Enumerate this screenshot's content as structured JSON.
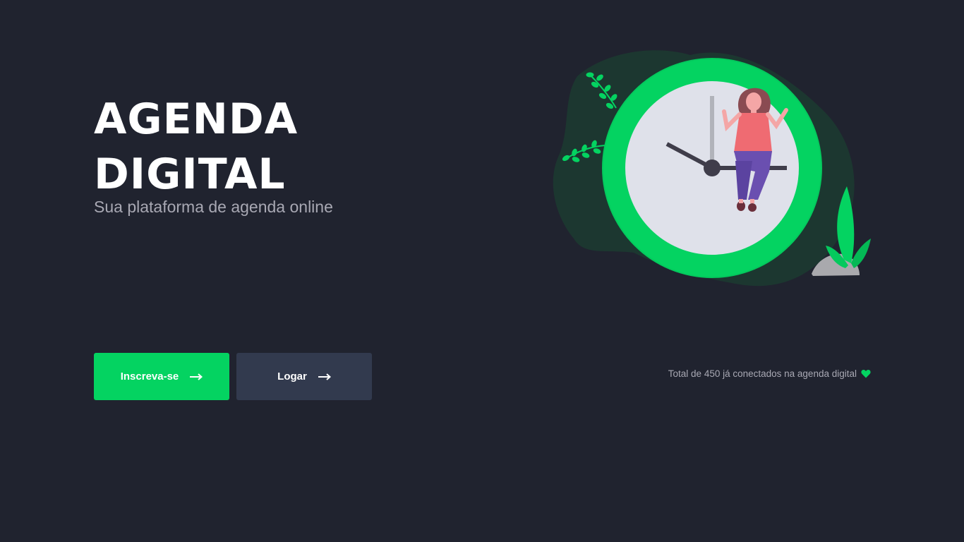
{
  "hero": {
    "title_line1": "AGENDA",
    "title_line2": "DIGITAL",
    "subtitle": "Sua plataforma de agenda online"
  },
  "buttons": {
    "signup_label": "Inscreva-se",
    "login_label": "Logar",
    "signup_icon": "arrow-right-icon",
    "login_icon": "arrow-right-icon"
  },
  "footer": {
    "connected_text": "Total de 450 já conectados na agenda digital",
    "heart_icon": "heart-icon"
  },
  "illustration": {
    "name": "clock-woman-illustration"
  },
  "colors": {
    "background": "#20232f",
    "accent": "#04d361",
    "button_secondary": "#323a4e",
    "muted_text": "#a8a8b3"
  }
}
